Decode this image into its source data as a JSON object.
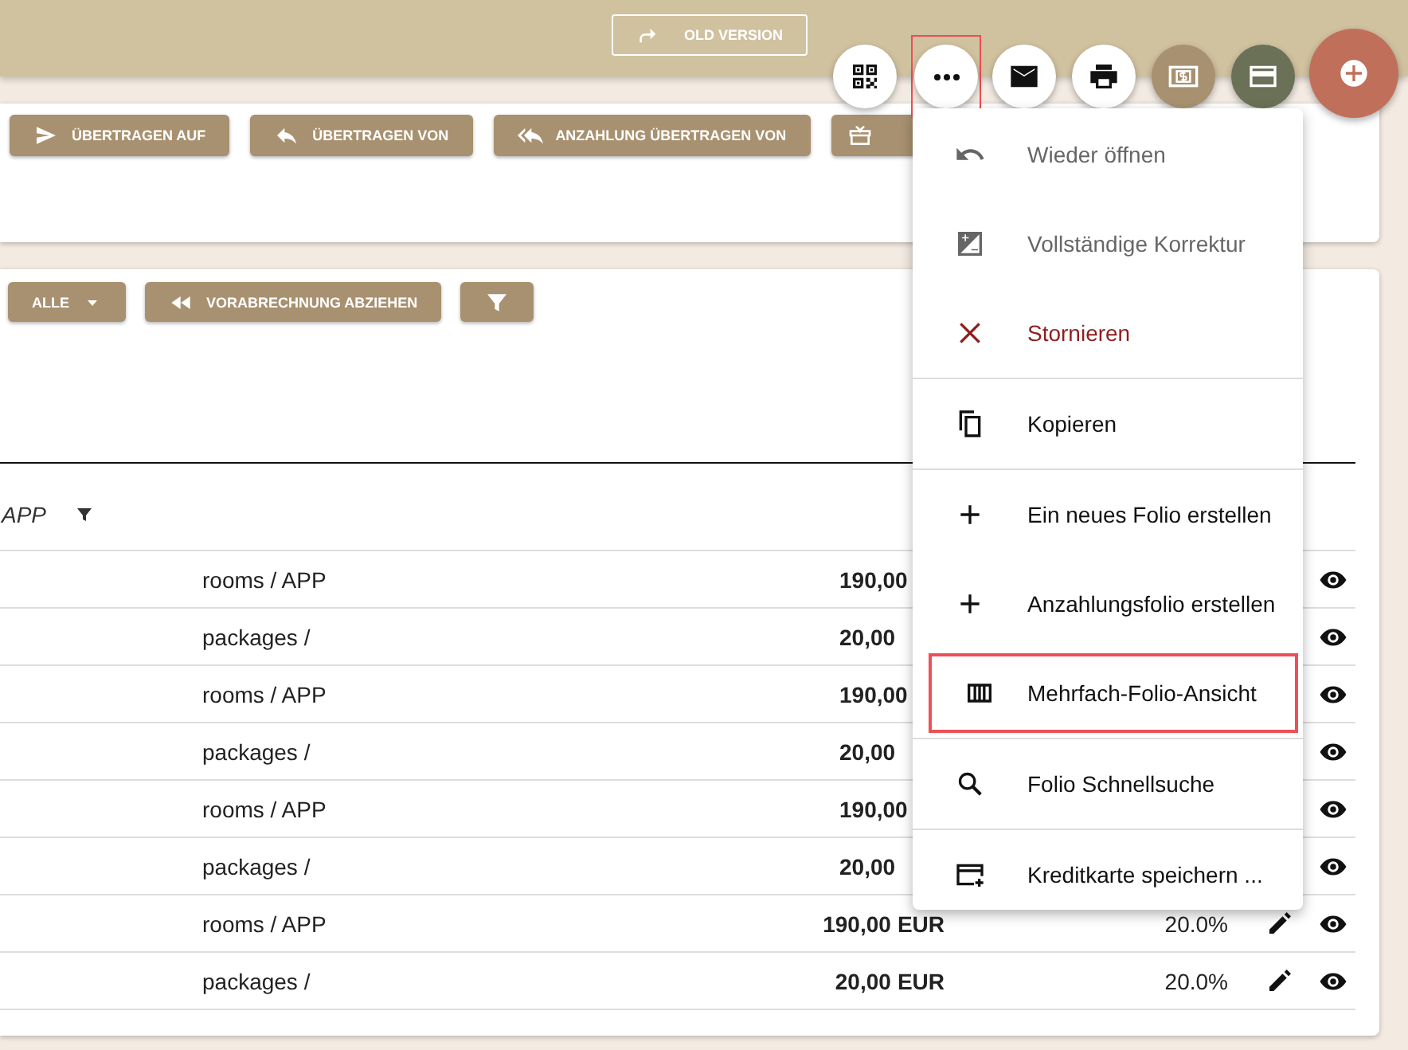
{
  "header": {
    "old_version_button": "OLD VERSION"
  },
  "action_buttons": [
    {
      "kind": "qr",
      "highlighted": false
    },
    {
      "kind": "more",
      "highlighted": true
    },
    {
      "kind": "mail",
      "highlighted": false
    },
    {
      "kind": "print",
      "highlighted": false
    },
    {
      "kind": "cash",
      "highlighted": false
    },
    {
      "kind": "card",
      "highlighted": false
    },
    {
      "kind": "add",
      "highlighted": false
    }
  ],
  "transfer_toolbar": [
    {
      "kind": "send",
      "label": "ÜBERTRAGEN AUF"
    },
    {
      "kind": "reply",
      "label": "ÜBERTRAGEN VON"
    },
    {
      "kind": "reply-all",
      "label": "ANZAHLUNG ÜBERTRAGEN VON"
    },
    {
      "kind": "gift"
    }
  ],
  "folio_toolbar": [
    {
      "kind": "dropdown",
      "label": "ALLE"
    },
    {
      "kind": "rewind",
      "label": "VORABRECHNUNG ABZIEHEN"
    },
    {
      "kind": "filter"
    }
  ],
  "table": {
    "header": {
      "column_1": "APP"
    },
    "rows": [
      {
        "item": "rooms / APP",
        "amount": "190,00"
      },
      {
        "item": "packages /",
        "amount": "20,00"
      },
      {
        "item": "rooms / APP",
        "amount": "190,00"
      },
      {
        "item": "packages /",
        "amount": "20,00"
      },
      {
        "item": "rooms / APP",
        "amount": "190,00"
      },
      {
        "item": "packages /",
        "amount": "20,00"
      },
      {
        "item": "rooms / APP",
        "amount": "190,00",
        "currency": "EUR",
        "tax": "20.0%",
        "edit": true
      },
      {
        "item": "packages /",
        "amount": "20,00",
        "currency": "EUR",
        "tax": "20.0%",
        "edit": true
      }
    ]
  },
  "menu": [
    {
      "label": "Wieder öffnen",
      "kind": "disabled",
      "divider_before": false,
      "highlighted": false
    },
    {
      "label": "Vollständige Korrektur",
      "kind": "disabled",
      "divider_before": false,
      "highlighted": false
    },
    {
      "label": "Stornieren",
      "kind": "danger",
      "divider_before": false,
      "highlighted": false
    },
    {
      "label": "Kopieren",
      "kind": "normal",
      "divider_before": true,
      "highlighted": false
    },
    {
      "label": "Ein neues Folio erstellen",
      "kind": "normal",
      "divider_before": true,
      "highlighted": false
    },
    {
      "label": "Anzahlungsfolio erstellen",
      "kind": "normal",
      "divider_before": false,
      "highlighted": false
    },
    {
      "label": "Mehrfach-Folio-Ansicht",
      "kind": "normal",
      "divider_before": false,
      "highlighted": true
    },
    {
      "label": "Folio Schnellsuche",
      "kind": "normal",
      "divider_before": true,
      "highlighted": false
    },
    {
      "label": "Kreditkarte speichern ...",
      "kind": "normal",
      "divider_before": true,
      "highlighted": false
    }
  ]
}
